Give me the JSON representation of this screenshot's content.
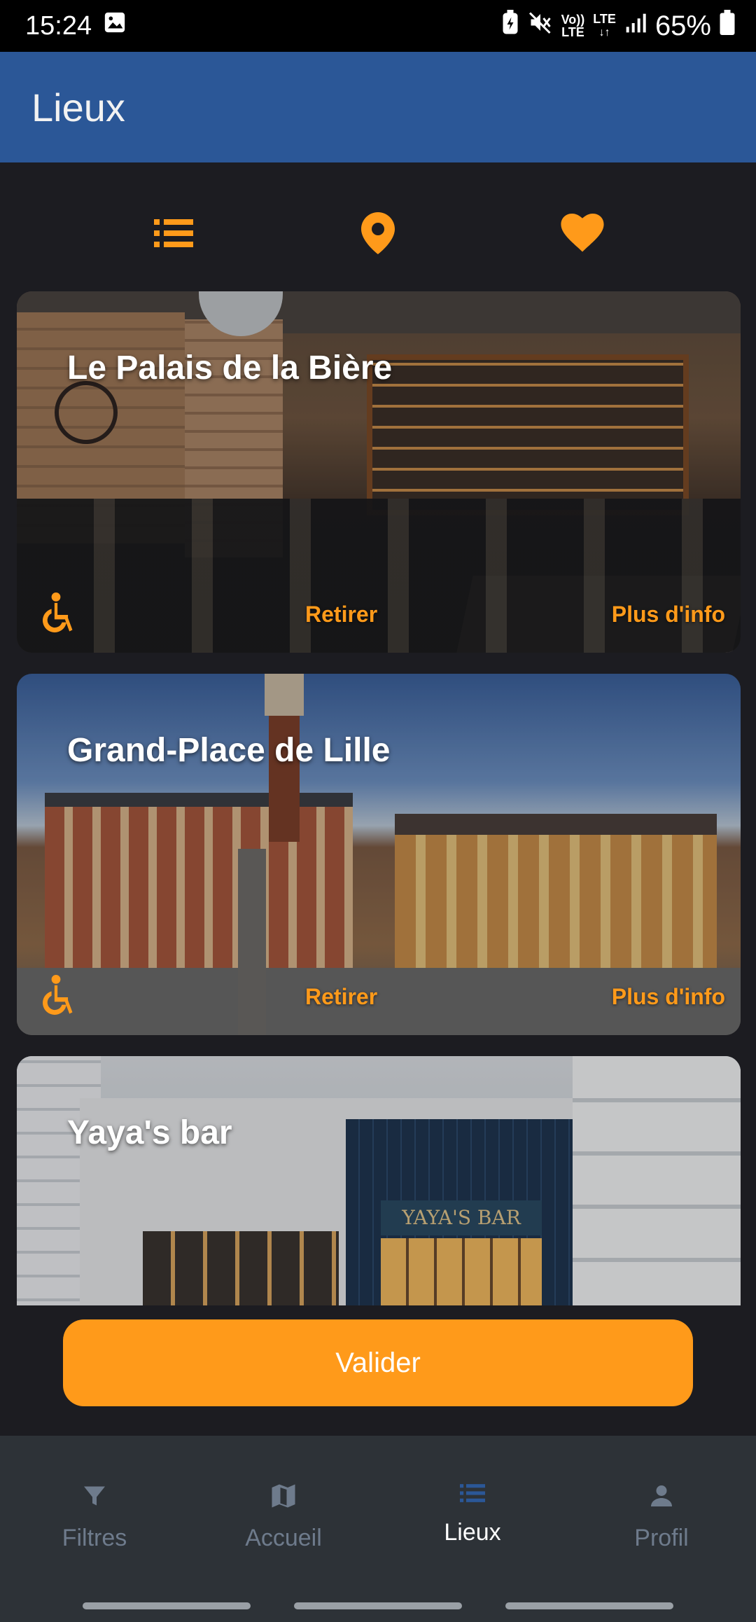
{
  "status_bar": {
    "time": "15:24",
    "volte_top": "Vo))",
    "volte_bottom": "LTE",
    "lte_label": "LTE",
    "battery_percent": "65%",
    "icons": [
      "gallery-icon",
      "battery-saver-icon",
      "mute-icon",
      "signal-icon",
      "battery-icon"
    ]
  },
  "app_bar": {
    "title": "Lieux"
  },
  "view_tabs": [
    {
      "name": "list-icon"
    },
    {
      "name": "map-pin-icon"
    },
    {
      "name": "heart-icon"
    }
  ],
  "places": [
    {
      "title": "Le Palais de la Bière",
      "remove_label": "Retirer",
      "more_label": "Plus d'info",
      "accessible": true
    },
    {
      "title": "Grand-Place de Lille",
      "remove_label": "Retirer",
      "more_label": "Plus d'info",
      "accessible": true
    },
    {
      "title": "Yaya's bar",
      "sign_text": "YAYA'S BAR"
    }
  ],
  "validate_button": {
    "label": "Valider"
  },
  "bottom_nav": {
    "items": [
      {
        "label": "Filtres",
        "icon": "filter-icon",
        "active": false
      },
      {
        "label": "Accueil",
        "icon": "map-icon",
        "active": false
      },
      {
        "label": "Lieux",
        "icon": "list-icon",
        "active": true
      },
      {
        "label": "Profil",
        "icon": "person-icon",
        "active": false
      }
    ]
  },
  "colors": {
    "app_bar": "#2b5797",
    "accent": "#ff9a1a",
    "background": "#1c1c21",
    "bottom_nav": "#2d3237",
    "nav_inactive": "#6e7b8c"
  }
}
